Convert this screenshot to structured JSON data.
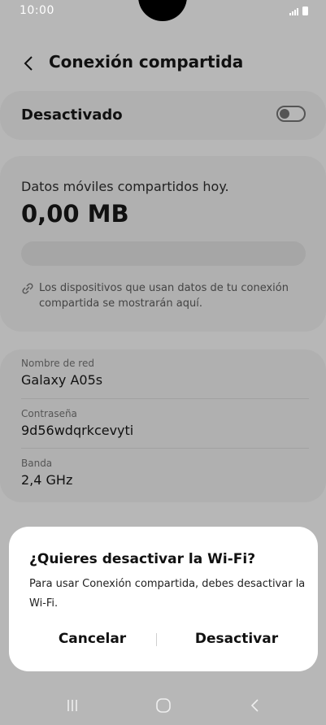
{
  "status_bar": {
    "time": "10:00"
  },
  "header": {
    "title": "Conexión compartida"
  },
  "toggle": {
    "label": "Desactivado",
    "on": false
  },
  "data_usage": {
    "label": "Datos móviles compartidos hoy.",
    "value": "0,00 MB",
    "progress": 0,
    "info": "Los dispositivos que usan datos de tu conexión compartida se mostrarán aquí."
  },
  "network": {
    "name_label": "Nombre de red",
    "name_value": "Galaxy A05s",
    "password_label": "Contraseña",
    "password_value": "9d56wdqrkcevyti",
    "band_label": "Banda",
    "band_value": "2,4 GHz"
  },
  "dialog": {
    "title": "¿Quieres desactivar la Wi-Fi?",
    "body": "Para usar Conexión compartida, debes desactivar la Wi-Fi.",
    "cancel_label": "Cancelar",
    "confirm_label": "Desactivar"
  },
  "colors": {
    "dim_background": "#b7b7b7",
    "card": "#b0b0b0",
    "dialog": "#ffffff"
  }
}
